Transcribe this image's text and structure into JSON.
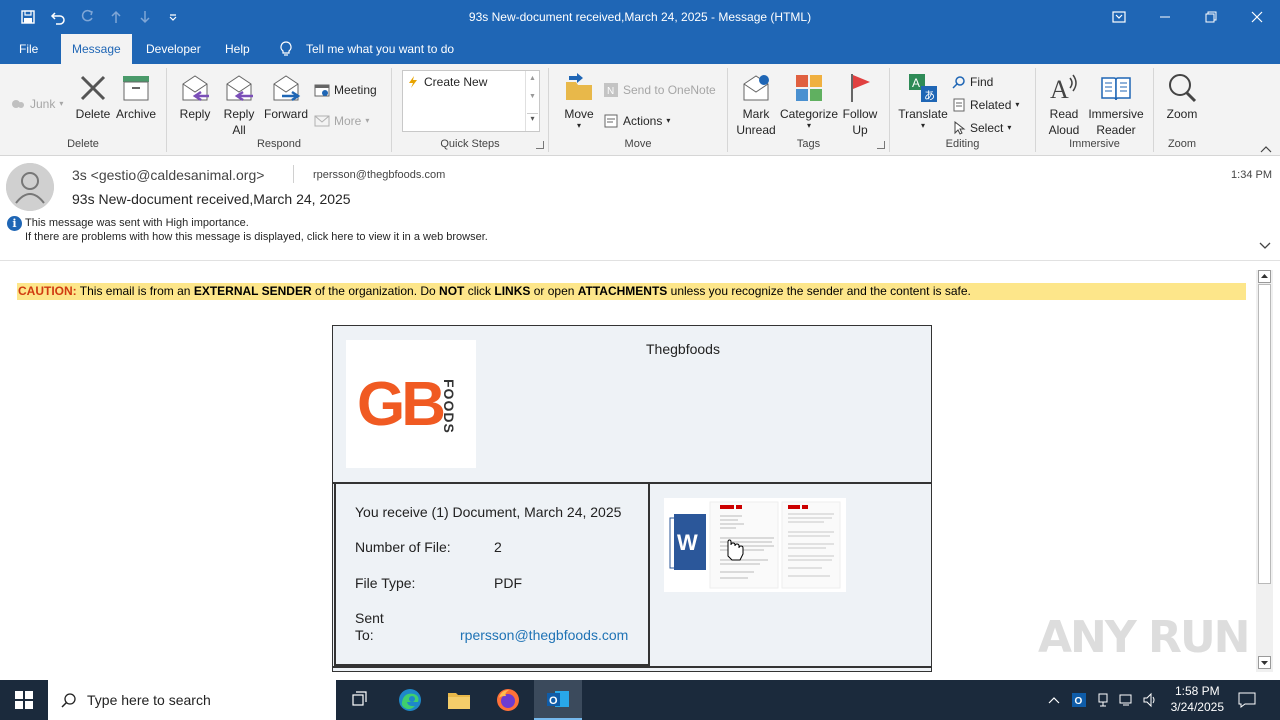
{
  "window": {
    "title": "93s New-document received,March 24, 2025  -  Message (HTML)"
  },
  "menu": {
    "tabs": [
      "File",
      "Message",
      "Developer",
      "Help"
    ],
    "tell_me": "Tell me what you want to do"
  },
  "ribbon": {
    "delete_group": {
      "label": "Delete",
      "junk": "Junk",
      "delete": "Delete",
      "archive": "Archive"
    },
    "respond_group": {
      "label": "Respond",
      "reply": "Reply",
      "reply_all_1": "Reply",
      "reply_all_2": "All",
      "forward": "Forward",
      "meeting": "Meeting",
      "more": "More"
    },
    "quicksteps_group": {
      "label": "Quick Steps",
      "create_new": "Create New"
    },
    "move_group": {
      "label": "Move",
      "move": "Move",
      "onenote": "Send to OneNote",
      "actions": "Actions"
    },
    "tags_group": {
      "label": "Tags",
      "mark_unread_1": "Mark",
      "mark_unread_2": "Unread",
      "categorize": "Categorize",
      "follow_up_1": "Follow",
      "follow_up_2": "Up"
    },
    "editing_group": {
      "label": "Editing",
      "translate": "Translate",
      "find": "Find",
      "related": "Related",
      "select": "Select"
    },
    "immersive_group": {
      "label": "Immersive",
      "read_aloud_1": "Read",
      "read_aloud_2": "Aloud",
      "reader_1": "Immersive",
      "reader_2": "Reader"
    },
    "zoom_group": {
      "label": "Zoom",
      "zoom": "Zoom"
    }
  },
  "message": {
    "from": "3s <gestio@caldesanimal.org>",
    "to": "rpersson@thegbfoods.com",
    "time": "1:34 PM",
    "subject": "93s New-document received,March 24, 2025",
    "importance": "This message was sent with High importance.",
    "display_problem": "If there are problems with how this message is displayed, click here to view it in a web browser."
  },
  "body": {
    "caution_label": "CAUTION:",
    "caution_parts": [
      " This email is from an ",
      "EXTERNAL SENDER",
      " of the organization. Do ",
      "NOT",
      " click ",
      "LINKS",
      " or open ",
      "ATTACHMENTS",
      "  unless you recognize the sender and the content is safe."
    ],
    "company": "Thegbfoods",
    "logo_text": "GB",
    "logo_sub": "FOODS",
    "receive_line": "You receive (1) Document, March 24, 2025",
    "number_label": "Number of File:",
    "number_value": "2",
    "type_label": "File Type:",
    "type_value": "PDF",
    "sent_label_1": "Sent",
    "sent_label_2": "To:",
    "sent_value": "rpersson@thegbfoods.com"
  },
  "watermark": "ANY RUN",
  "taskbar": {
    "search_placeholder": "Type here to search",
    "time": "1:58 PM",
    "date": "3/24/2025"
  },
  "colors": {
    "accent": "#1f66b5",
    "caution_bg": "#fde68a",
    "caution_red": "#d03b10",
    "logo_orange": "#f05a22",
    "link": "#1f73b5"
  }
}
